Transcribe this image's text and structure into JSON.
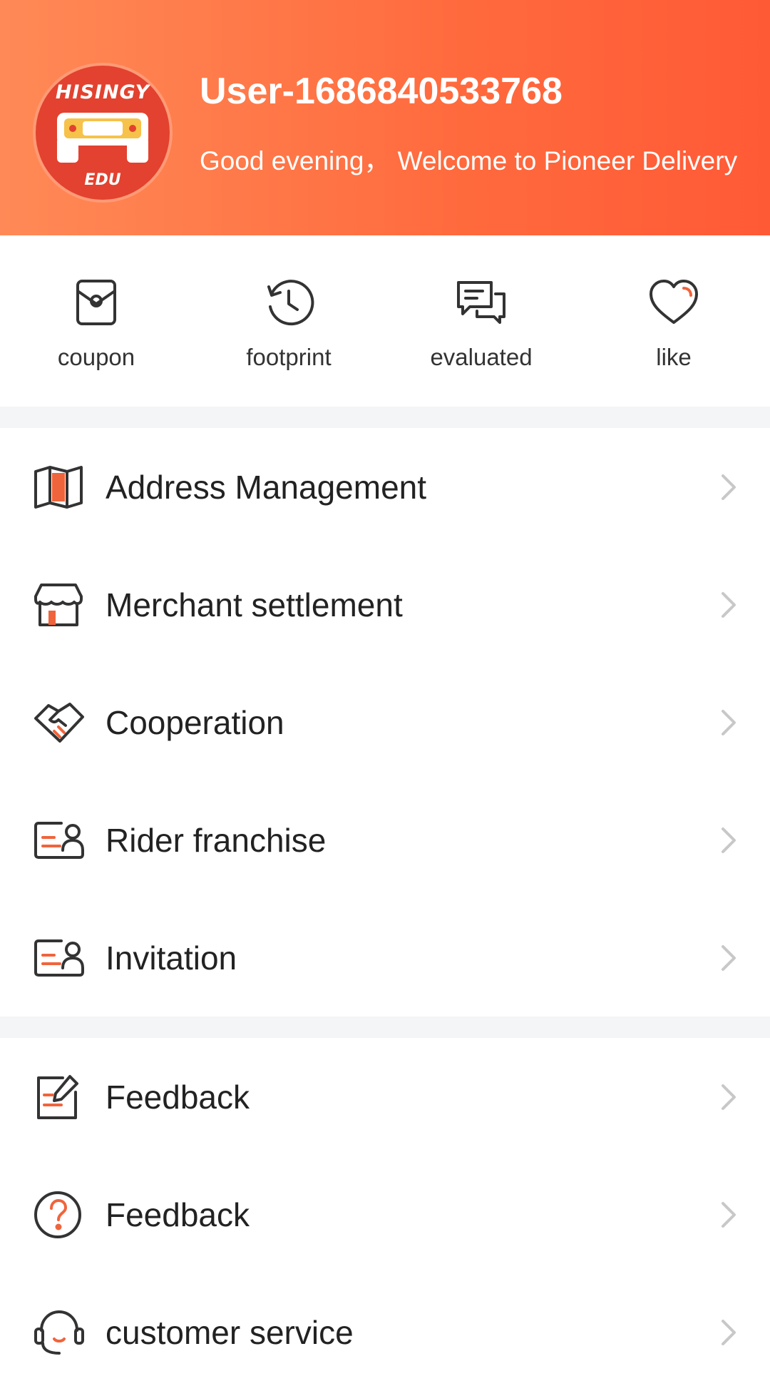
{
  "header": {
    "avatar": {
      "top_text": "HISINGY",
      "bottom_text": "EDU"
    },
    "username": "User-1686840533768",
    "greeting": "Good evening，  Welcome to Pioneer Delivery"
  },
  "quick_actions": [
    {
      "label": "coupon",
      "icon": "coupon-icon"
    },
    {
      "label": "footprint",
      "icon": "history-icon"
    },
    {
      "label": "evaluated",
      "icon": "comment-icon"
    },
    {
      "label": "like",
      "icon": "heart-icon"
    }
  ],
  "menu_group_1": [
    {
      "label": "Address Management",
      "icon": "map-icon"
    },
    {
      "label": "Merchant settlement",
      "icon": "store-icon"
    },
    {
      "label": "Cooperation",
      "icon": "handshake-icon"
    },
    {
      "label": "Rider franchise",
      "icon": "id-card-icon"
    },
    {
      "label": "Invitation",
      "icon": "id-card-icon"
    }
  ],
  "menu_group_2": [
    {
      "label": "Feedback",
      "icon": "edit-note-icon"
    },
    {
      "label": "Feedback",
      "icon": "question-icon"
    },
    {
      "label": "customer service",
      "icon": "headset-icon"
    }
  ],
  "colors": {
    "accent": "#ff6a3d",
    "icon_stroke": "#333333",
    "icon_accent": "#f0643c",
    "chevron": "#c8c8c8",
    "separator": "#f4f5f7"
  }
}
